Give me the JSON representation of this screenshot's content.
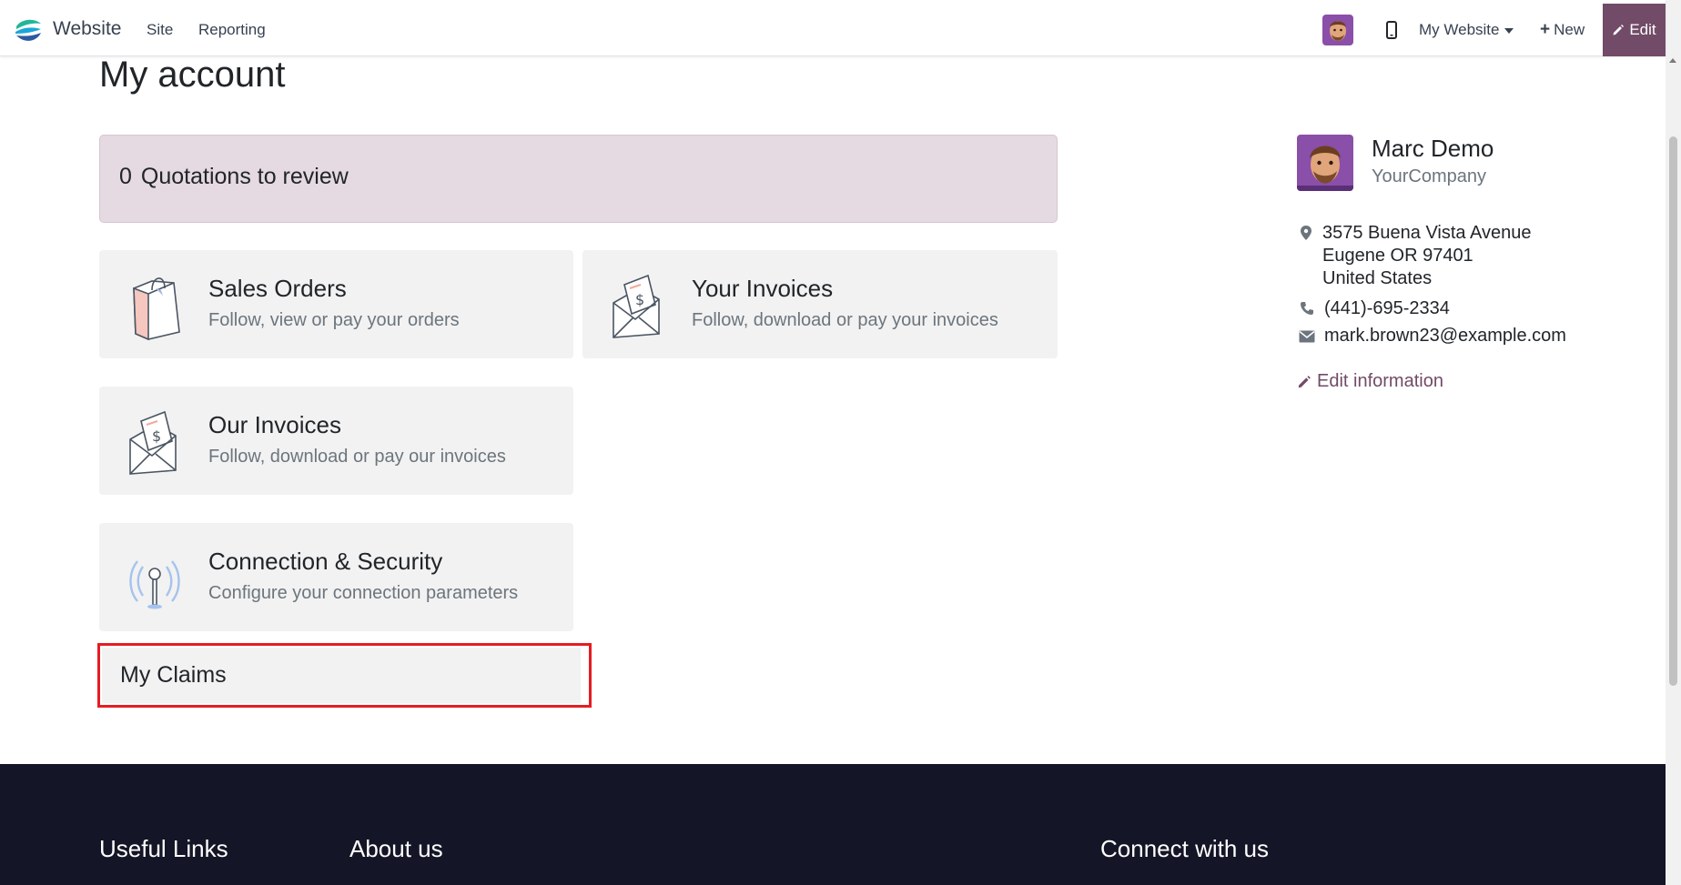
{
  "topbar": {
    "brand": "Website",
    "nav_site": "Site",
    "nav_reporting": "Reporting",
    "website_selector": "My Website",
    "new_label": "New",
    "edit_label": "Edit"
  },
  "page": {
    "title": "My account"
  },
  "alert": {
    "count": "0",
    "label": "Quotations to review"
  },
  "cards": {
    "sales": {
      "title": "Sales Orders",
      "desc": "Follow, view or pay your orders"
    },
    "your_invoices": {
      "title": "Your Invoices",
      "desc": "Follow, download or pay your invoices"
    },
    "our_invoices": {
      "title": "Our Invoices",
      "desc": "Follow, download or pay our invoices"
    },
    "connection": {
      "title": "Connection & Security",
      "desc": "Configure your connection parameters"
    },
    "claims": {
      "title": "My Claims"
    }
  },
  "profile": {
    "name": "Marc Demo",
    "company": "YourCompany",
    "address_line1": "3575 Buena Vista Avenue",
    "address_line2": "Eugene OR 97401",
    "address_line3": "United States",
    "phone": "(441)-695-2334",
    "email": "mark.brown23@example.com",
    "edit_label": "Edit information"
  },
  "footer": {
    "useful_links": "Useful Links",
    "about_us": "About us",
    "connect": "Connect with us"
  },
  "colors": {
    "brand_purple": "#714b67",
    "alert_bg": "#e5dae1",
    "card_bg": "#f2f2f2",
    "footer_bg": "#141627",
    "highlight_red": "#e51c23"
  }
}
